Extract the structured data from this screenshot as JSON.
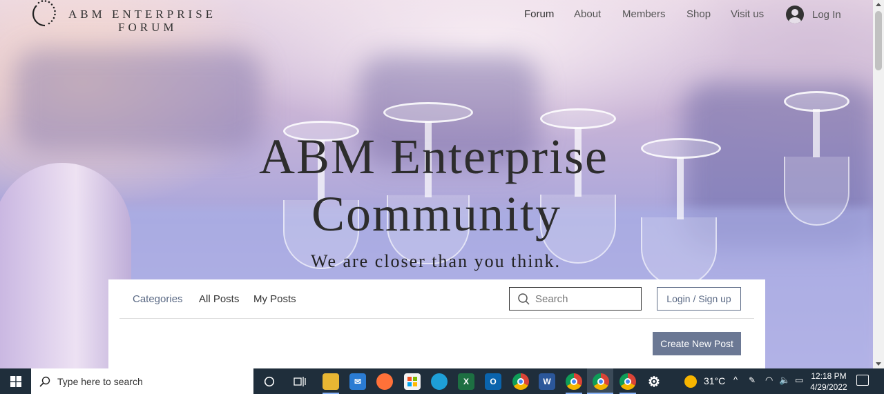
{
  "site": {
    "brand_line1": "ABM ENTERPRISE",
    "brand_line2": "FORUM"
  },
  "nav": {
    "items": [
      {
        "label": "Forum"
      },
      {
        "label": "About"
      },
      {
        "label": "Members"
      },
      {
        "label": "Shop"
      },
      {
        "label": "Visit us"
      }
    ],
    "login_label": "Log In"
  },
  "hero": {
    "title_line1": "ABM Enterprise",
    "title_line2": "Community",
    "subtitle": "We are closer than you think."
  },
  "forum": {
    "tabs": [
      {
        "label": "Categories",
        "active": true
      },
      {
        "label": "All Posts",
        "active": false
      },
      {
        "label": "My Posts",
        "active": false
      }
    ],
    "search_placeholder": "Search",
    "login_signup_label": "Login / Sign up",
    "create_post_label": "Create New Post"
  },
  "taskbar": {
    "search_placeholder": "Type here to search",
    "pinned_icons": [
      "cortana-icon",
      "task-view-icon",
      "file-explorer-icon",
      "mail-icon",
      "firefox-icon",
      "microsoft-store-icon",
      "edge-icon",
      "excel-icon",
      "outlook-icon",
      "chrome-icon",
      "word-icon",
      "chrome-profile-m-icon",
      "chrome-profile-b-icon",
      "chrome-icon-2",
      "settings-icon"
    ],
    "weather": "31°C",
    "time": "12:18 PM",
    "date": "4/29/2022"
  },
  "colors": {
    "accent": "#5b6a85",
    "button_bg": "#6b7894",
    "taskbar_bg": "#1f2e3b"
  }
}
